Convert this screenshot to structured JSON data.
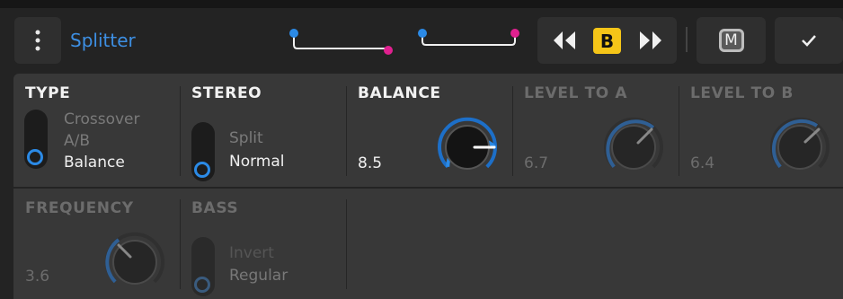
{
  "header": {
    "title": "Splitter",
    "menu_icon": "vertical-ellipsis-icon",
    "routing_icons": [
      "routing-a-icon",
      "routing-b-icon"
    ],
    "transport": {
      "prev_icon": "previous-icon",
      "badge": "B",
      "next_icon": "next-icon"
    },
    "m_label": "M",
    "confirm_icon": "check-icon"
  },
  "colors": {
    "accent": "#2b8ae6",
    "pink": "#e0208f",
    "badge_yellow": "#f5c518",
    "title_blue": "#3d8fe3"
  },
  "params": {
    "type": {
      "label": "TYPE",
      "options": [
        "Crossover",
        "A/B",
        "Balance"
      ],
      "selected": "Balance"
    },
    "stereo": {
      "label": "STEREO",
      "options": [
        "Split",
        "Normal"
      ],
      "selected": "Normal"
    },
    "balance": {
      "label": "BALANCE",
      "value": "8.5"
    },
    "level_a": {
      "label": "LEVEL TO A",
      "value": "6.7"
    },
    "level_b": {
      "label": "LEVEL TO B",
      "value": "6.4"
    },
    "frequency": {
      "label": "FREQUENCY",
      "value": "3.6"
    },
    "bass": {
      "label": "BASS",
      "options": [
        "Invert",
        "Regular"
      ],
      "selected": "Regular"
    }
  }
}
